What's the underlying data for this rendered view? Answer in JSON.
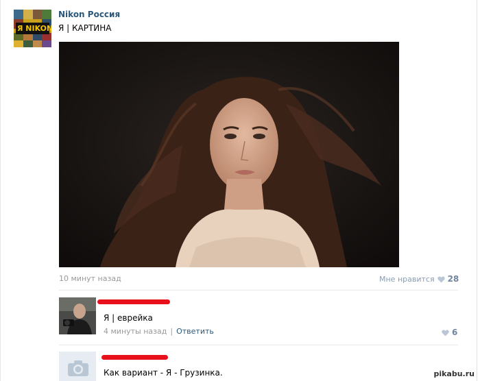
{
  "post": {
    "author": "Nikon Россия",
    "avatar_label": "Я NIKON",
    "text": "Я | КАРТИНА",
    "time": "10 минут назад",
    "like_label": "Мне нравится",
    "like_count": "28"
  },
  "comments": [
    {
      "text": "Я | еврейка",
      "time": "4 минуты назад",
      "separator": "|",
      "reply_label": "Ответить",
      "like_count": "6"
    },
    {
      "text": "Как вариант - Я - Грузинка."
    }
  ],
  "watermark": "pikabu.ru",
  "colors": {
    "link": "#2b587a",
    "meta": "#999999",
    "redaction": "#e8101a"
  }
}
